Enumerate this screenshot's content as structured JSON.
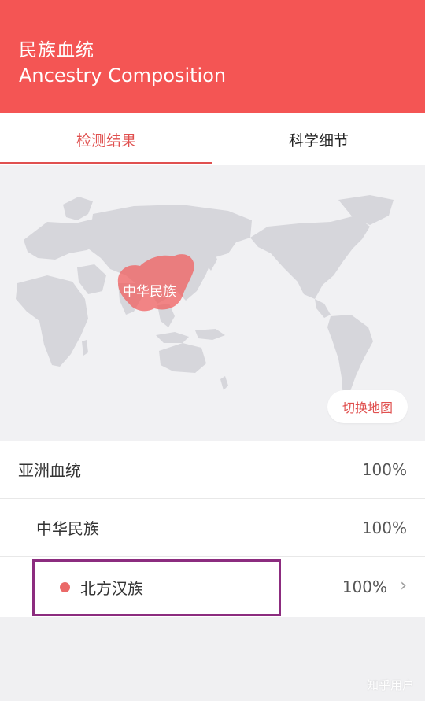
{
  "header": {
    "title_cn": "民族血统",
    "title_en": "Ancestry Composition"
  },
  "tabs": [
    {
      "label": "检测结果",
      "active": true
    },
    {
      "label": "科学细节",
      "active": false
    }
  ],
  "map": {
    "region_label": "中华民族",
    "switch_button": "切换地图",
    "region_color": "#f15a5a"
  },
  "rows": [
    {
      "label": "亚洲血统",
      "percent": "100%"
    },
    {
      "label": "中华民族",
      "percent": "100%"
    },
    {
      "label": "北方汉族",
      "percent": "100%",
      "dot_color": "#ea6968"
    }
  ],
  "watermark": "知乎用户",
  "colors": {
    "accent": "#f45554",
    "text_accent": "#e0504f",
    "highlight": "#8c2c7f"
  }
}
